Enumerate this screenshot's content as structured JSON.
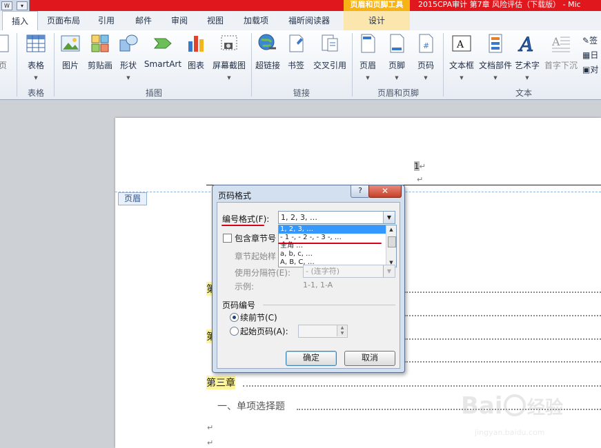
{
  "titlebar": {
    "context_group": "页眉和页脚工具",
    "document_title": "2015CPA审计 第7章  风险评估（下载版） - Mic"
  },
  "tabs": {
    "insert": "插入",
    "layout": "页面布局",
    "references": "引用",
    "mailings": "邮件",
    "review": "审阅",
    "view": "视图",
    "addins": "加载项",
    "foxit": "福昕阅读器",
    "design": "设计"
  },
  "ribbon": {
    "partial_left_label": "页",
    "table": {
      "label": "表格",
      "group": "表格"
    },
    "illustrations": {
      "picture": "图片",
      "clipart": "剪贴画",
      "shapes": "形状",
      "smartart": "SmartArt",
      "chart": "图表",
      "screenshot": "屏幕截图",
      "group": "插图"
    },
    "links": {
      "hyperlink": "超链接",
      "bookmark": "书签",
      "crossref": "交叉引用",
      "group": "链接"
    },
    "header_footer": {
      "header": "页眉",
      "footer": "页脚",
      "page_number": "页码",
      "group": "页眉和页脚"
    },
    "text": {
      "textbox": "文本框",
      "quickparts": "文档部件",
      "wordart": "艺术字",
      "dropcap": "首字下沉",
      "group": "文本",
      "mini1": "签",
      "mini2": "日",
      "mini3": "对"
    }
  },
  "document": {
    "header_tag": "页眉",
    "header_marker": "1",
    "chapter3": "第三章",
    "section1": "一、单项选择题",
    "partial_ch": "第"
  },
  "dialog": {
    "title": "页码格式",
    "help": "?",
    "close": "✕",
    "number_format_label": "编号格式(F):",
    "number_format_value": "1, 2, 3, …",
    "options": [
      "1, 2, 3, …",
      "- 1 -, - 2 -, - 3 -, …",
      "全角 …",
      "a, b, c, …",
      "A, B, C, …"
    ],
    "include_chapter_label": "包含章节号",
    "chapter_style_label": "章节起始样",
    "separator_label": "使用分隔符(E):",
    "separator_value": "-   (连字符)",
    "example_label": "示例:",
    "example_value": "1-1, 1-A",
    "page_numbering_label": "页码编号",
    "continue_label": "续前节(C)",
    "start_at_label": "起始页码(A):",
    "ok": "确定",
    "cancel": "取消"
  },
  "watermark": {
    "brand": "Bai du 经验",
    "url": "jingyan.baidu.com"
  }
}
